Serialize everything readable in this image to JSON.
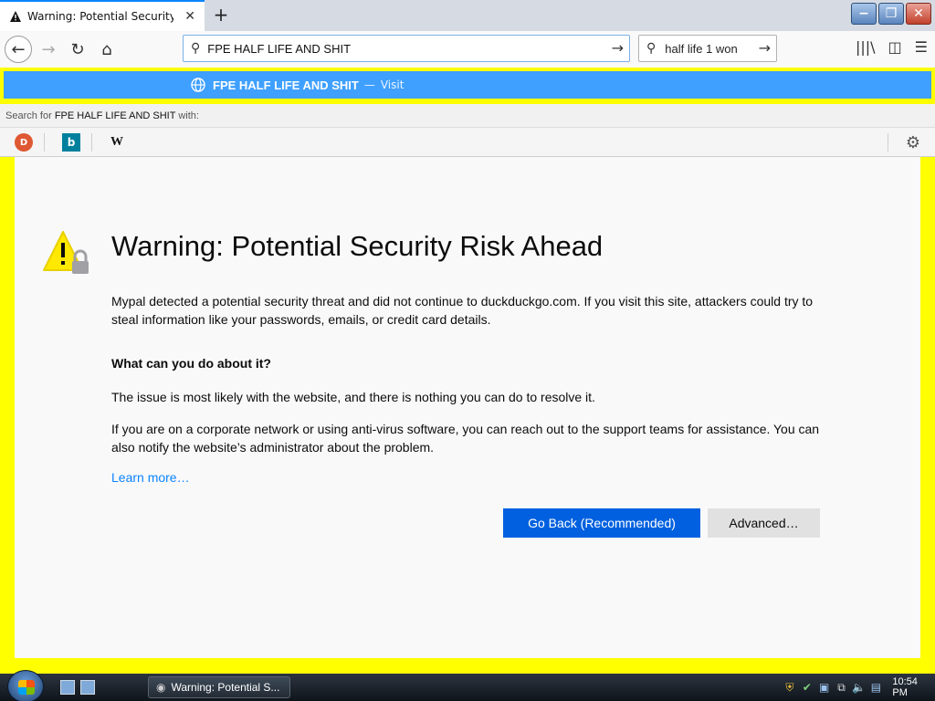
{
  "browser": {
    "tab": {
      "title": "Warning: Potential Security Risk Ahead"
    },
    "url": "FPE HALF LIFE AND SHIT",
    "search": "half life 1 won",
    "dropdown": {
      "visit_title": "FPE HALF LIFE AND SHIT",
      "visit_sep": "—",
      "visit_label": "Visit",
      "searchfor_prefix": "Search for",
      "searchfor_query": "FPE HALF LIFE AND SHIT",
      "searchfor_suffix": "with:"
    },
    "engines": [
      {
        "name": "DuckDuckGo",
        "glyph": "D"
      },
      {
        "name": "Bing",
        "glyph": "b"
      },
      {
        "name": "Wikipedia",
        "glyph": "W"
      }
    ]
  },
  "error_page": {
    "title": "Warning: Potential Security Risk Ahead",
    "intro": "Mypal detected a potential security threat and did not continue to duckduckgo.com. If you visit this site, attackers could try to steal information like your passwords, emails, or credit card details.",
    "subheading": "What can you do about it?",
    "p2": "The issue is most likely with the website, and there is nothing you can do to resolve it.",
    "p3": "If you are on a corporate network or using anti-virus software, you can reach out to the support teams for assistance. You can also notify the website’s administrator about the problem.",
    "learn_more": "Learn more…",
    "btn_back": "Go Back (Recommended)",
    "btn_advanced": "Advanced…"
  },
  "taskbar": {
    "task_label": "Warning: Potential S...",
    "clock": "10:54 PM"
  },
  "colors": {
    "accent": "#0a84ff",
    "primary_button": "#0060df",
    "frame": "#ffff00",
    "dropdown_highlight": "#3fa0ff"
  }
}
